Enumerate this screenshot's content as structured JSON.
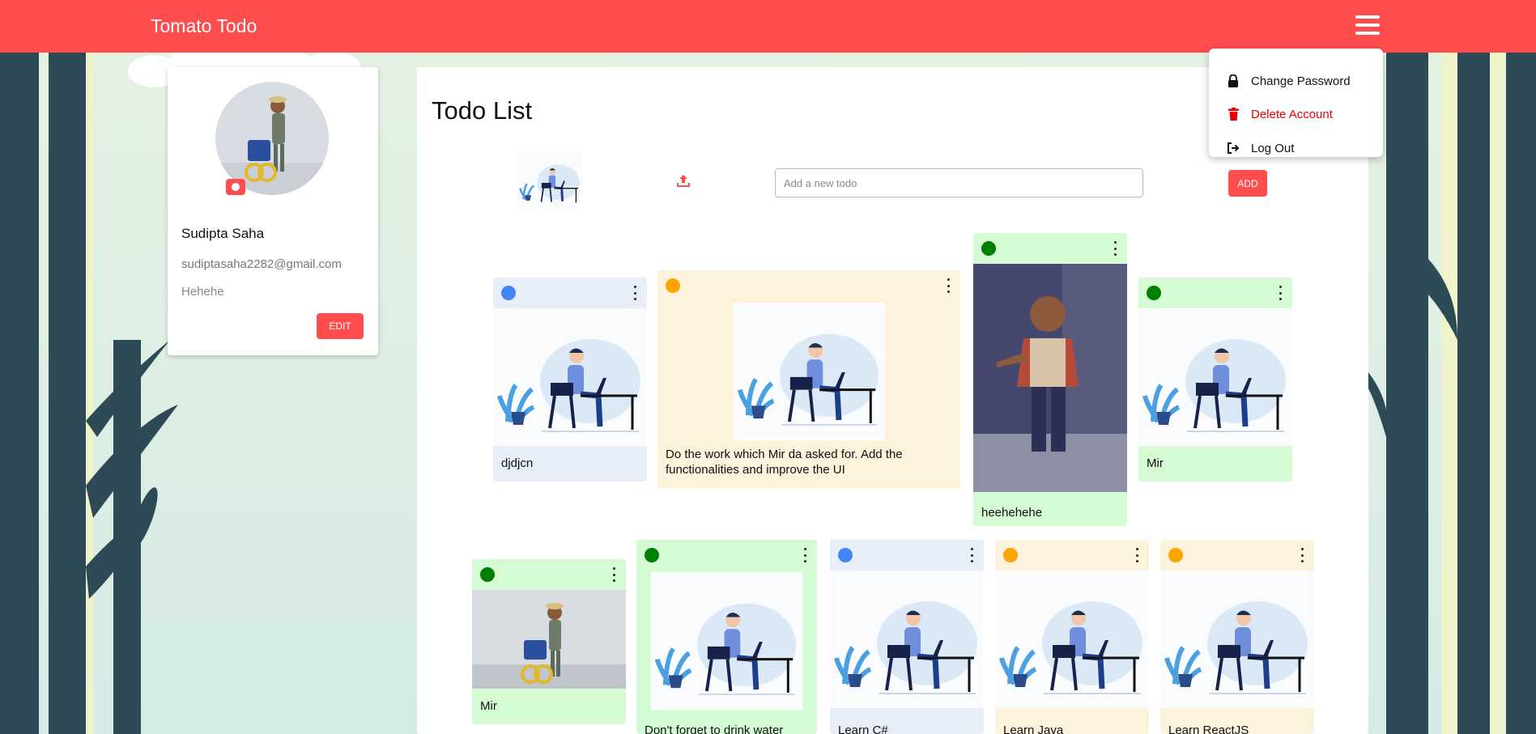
{
  "app": {
    "brand": "Tomato Todo"
  },
  "menu": {
    "items": [
      {
        "label": "Change Password",
        "icon": "lock-icon"
      },
      {
        "label": "Delete Account",
        "icon": "trash-icon"
      },
      {
        "label": "Log Out",
        "icon": "logout-icon"
      }
    ]
  },
  "profile": {
    "name": "Sudipta Saha",
    "email": "sudiptasaha2282@gmail.com",
    "bio": "Hehehe",
    "edit_label": "EDIT"
  },
  "main": {
    "title": "Todo List",
    "input_placeholder": "Add a new todo",
    "add_label": "ADD"
  },
  "colors": {
    "accent": "#ff4d4d",
    "priority_low": "#4285f4",
    "priority_medium": "#ffa500",
    "priority_high": "#008000",
    "bg_low": "#e8eef8",
    "bg_medium": "#fdf2dc",
    "bg_high": "#d4fbd4"
  },
  "todos": [
    {
      "text": "djdjcn",
      "priority": "low",
      "image": "illustration"
    },
    {
      "text": "Do the work which Mir da asked for. Add the functionalities and improve the UI",
      "priority": "medium",
      "image": "illustration"
    },
    {
      "text": "heehehehe",
      "priority": "high",
      "image": "photo-child"
    },
    {
      "text": "Mir",
      "priority": "high",
      "image": "illustration"
    },
    {
      "text": "Mir",
      "priority": "high",
      "image": "photo-boy"
    },
    {
      "text": "Don't forget to drink water",
      "priority": "high",
      "image": "illustration"
    },
    {
      "text": "Learn C#",
      "priority": "low",
      "image": "illustration"
    },
    {
      "text": "Learn Java",
      "priority": "medium",
      "image": "illustration"
    },
    {
      "text": "Learn ReactJS",
      "priority": "medium",
      "image": "illustration"
    }
  ]
}
